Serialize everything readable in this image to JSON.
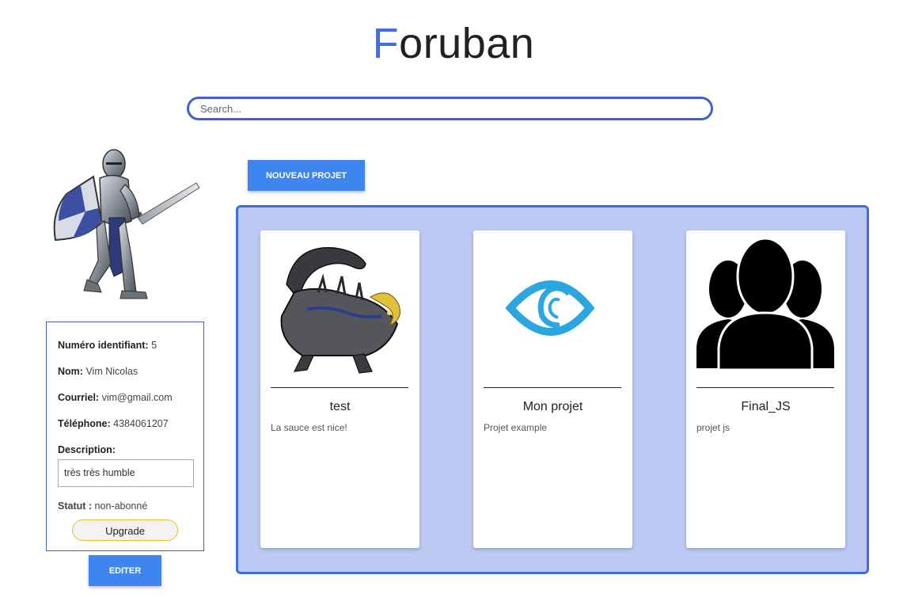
{
  "header": {
    "logo_first": "F",
    "logo_rest": "oruban",
    "accent_color": "#3f6fe0"
  },
  "search": {
    "placeholder": "Search...",
    "value": ""
  },
  "profile": {
    "avatar_icon": "knight-avatar",
    "id_label": "Numéro identifiant:",
    "id_value": "5",
    "name_label": "Nom:",
    "name_value": "Vim Nicolas",
    "email_label": "Courriel:",
    "email_value": "vim@gmail.com",
    "phone_label": "Téléphone:",
    "phone_value": "4384061207",
    "description_label": "Description:",
    "description_value": "très très humble",
    "status_label": "Statut :",
    "status_value": "non-abonné",
    "upgrade_label": "Upgrade",
    "edit_label": "EDITER"
  },
  "actions": {
    "new_project_label": "NOUVEAU PROJET"
  },
  "projects": [
    {
      "title": "test",
      "description": "La sauce est nice!",
      "image_icon": "dragon-image"
    },
    {
      "title": "Mon projet",
      "description": "Projet example",
      "image_icon": "eye-logo-icon"
    },
    {
      "title": "Final_JS",
      "description": "projet js",
      "image_icon": "group-icon"
    }
  ],
  "colors": {
    "primary_button": "#3f85f0",
    "projects_bg": "#bccaf3",
    "projects_border": "#3d6de0",
    "upgrade_border": "#e6be2a"
  }
}
